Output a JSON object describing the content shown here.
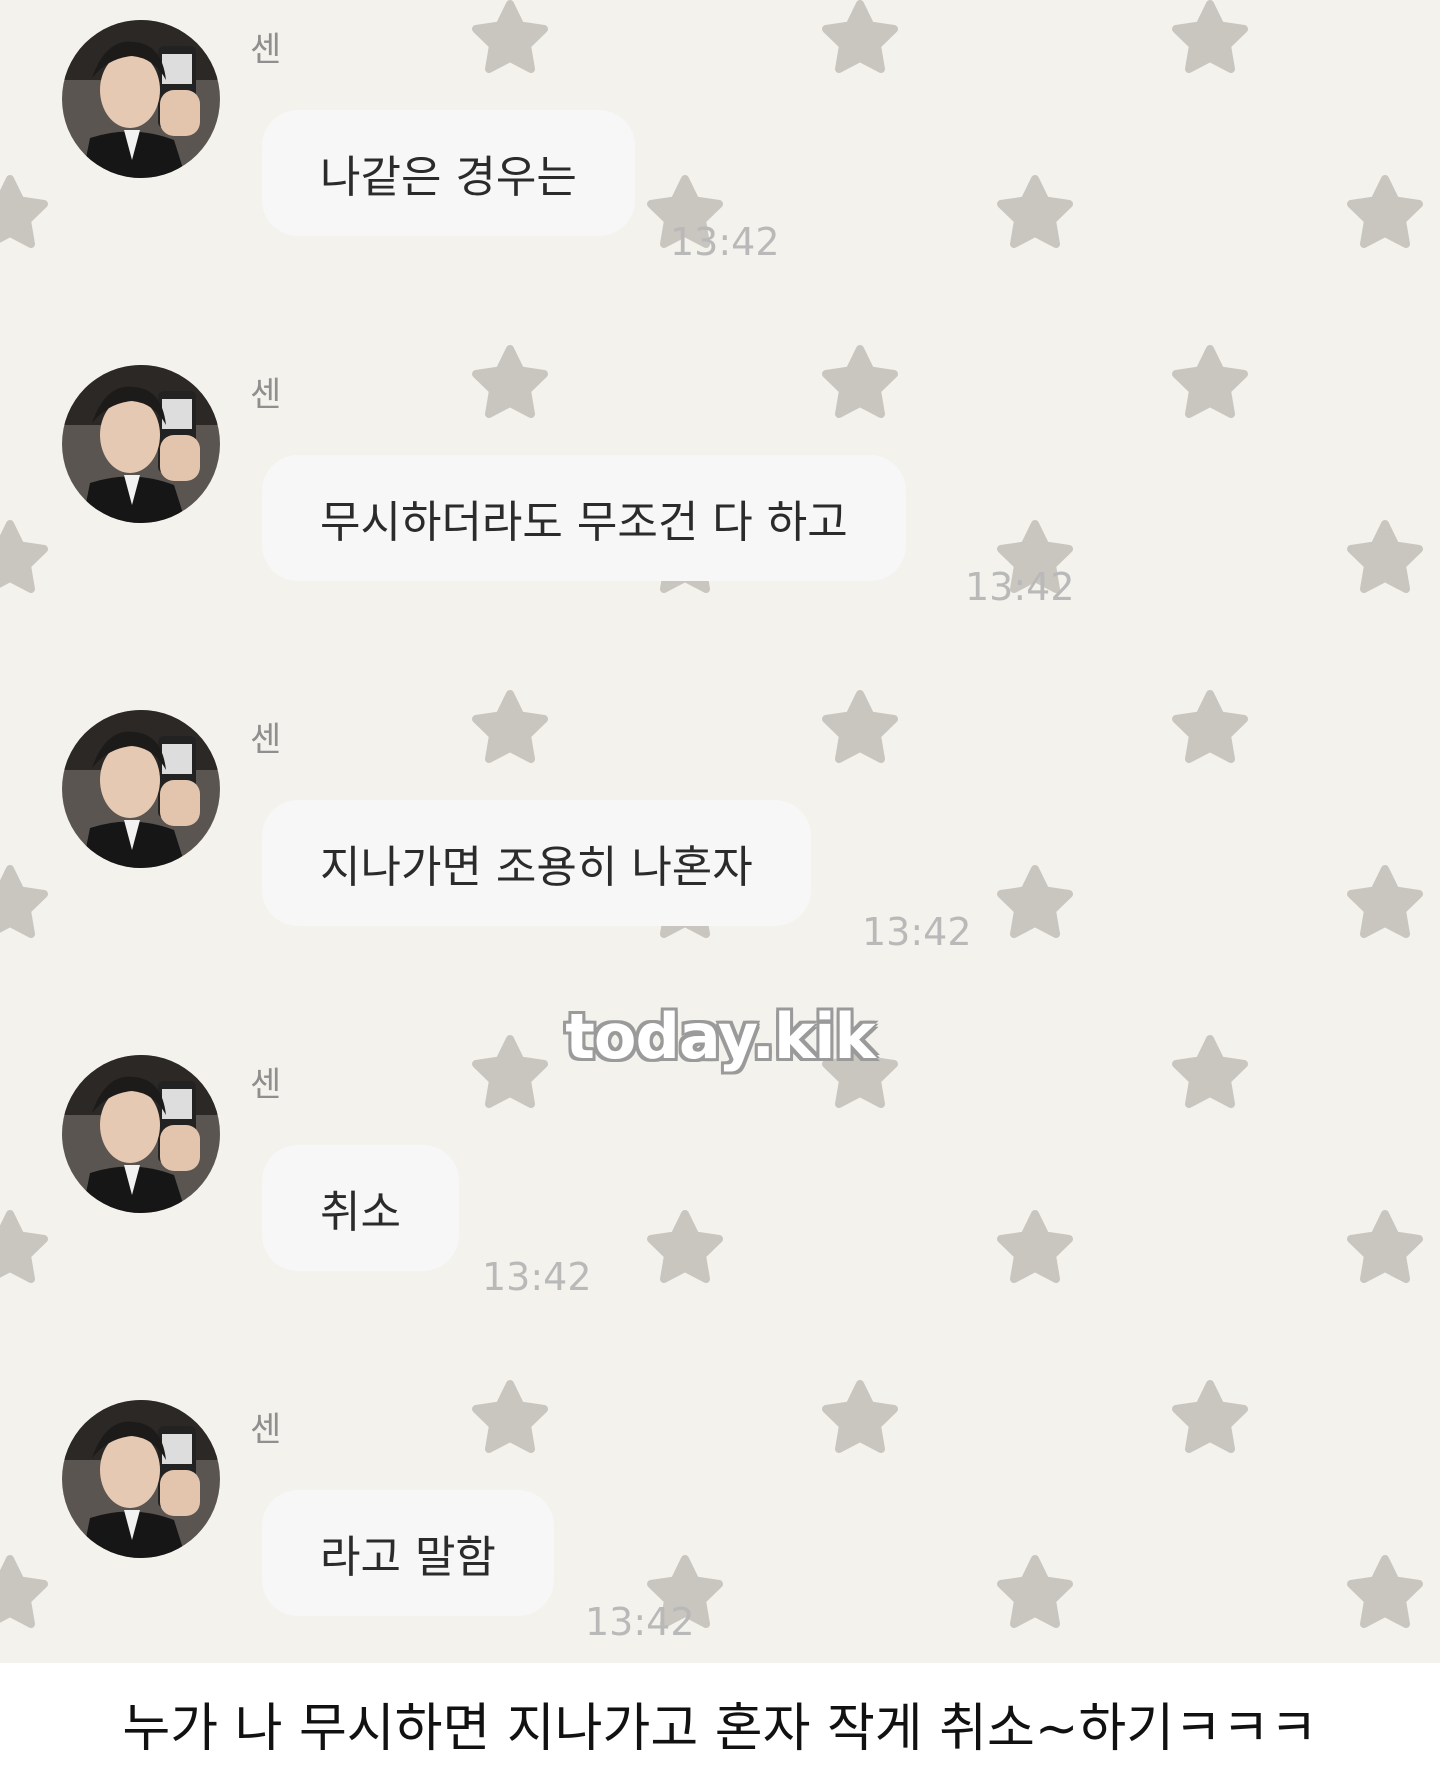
{
  "messages": [
    {
      "sender": "센",
      "text": "나같은 경우는",
      "time": "13:42"
    },
    {
      "sender": "센",
      "text": "무시하더라도 무조건 다 하고",
      "time": "13:42"
    },
    {
      "sender": "센",
      "text": "지나가면 조용히 나혼자",
      "time": "13:42"
    },
    {
      "sender": "센",
      "text": "취소",
      "time": "13:42"
    },
    {
      "sender": "센",
      "text": "라고 말함",
      "time": "13:42"
    }
  ],
  "watermark": "today.kik",
  "caption": "누가 나 무시하면 지나가고 혼자 작게 취소~하기ㅋㅋㅋ",
  "colors": {
    "chat_background": "#f4f2ec",
    "star": "#c9c5bf",
    "bubble": "#f7f7f7",
    "timestamp": "#b9b9b9",
    "sender_name": "#8f8f8f"
  }
}
